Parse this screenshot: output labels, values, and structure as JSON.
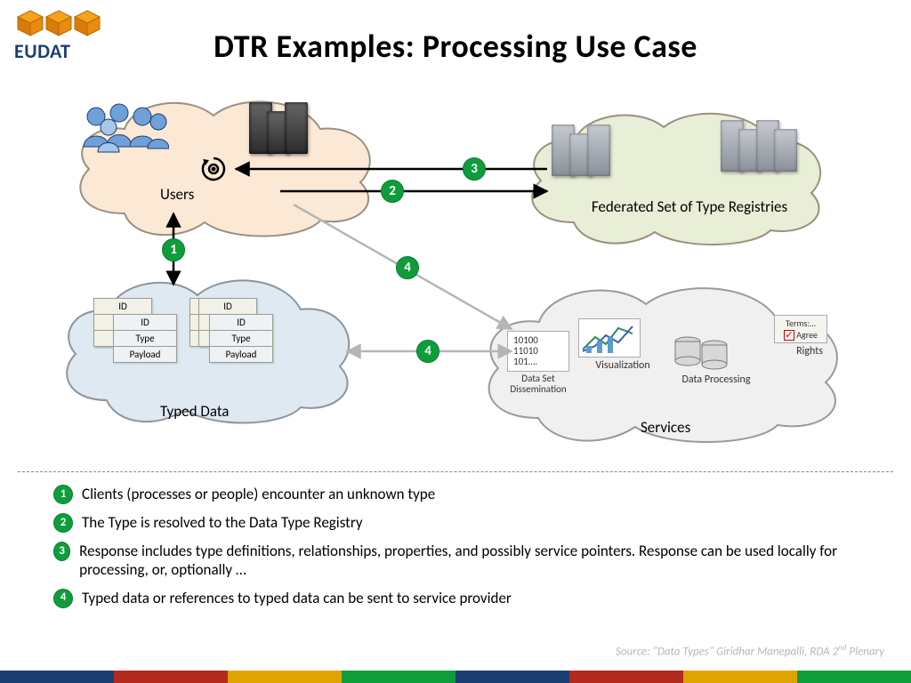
{
  "brand": {
    "name": "EUDAT"
  },
  "title": "DTR Examples: Processing Use Case",
  "clouds": {
    "users": {
      "label": "Users"
    },
    "registries": {
      "label": "Federated Set of Type Registries"
    },
    "typed": {
      "label": "Typed Data",
      "card": {
        "id": "ID",
        "type": "Type",
        "payload": "Payload"
      }
    },
    "services": {
      "label": "Services",
      "dataset_bits": "10100\n11010\n101….",
      "dataset_label": "Data Set Dissemination",
      "visualization": "Visualization",
      "processing": "Data Processing",
      "terms_header": "Terms:…",
      "terms_agree": "Agree",
      "rights": "Rights"
    }
  },
  "arrows": {
    "a1": "1",
    "a2": "2",
    "a3": "3",
    "a4a": "4",
    "a4b": "4"
  },
  "legend": [
    {
      "n": "1",
      "text": "Clients (processes or people) encounter an unknown type"
    },
    {
      "n": "2",
      "text": "The Type is resolved to the Data Type Registry"
    },
    {
      "n": "3",
      "text": "Response includes type definitions, relationships, properties, and possibly service pointers. Response can be used locally for processing, or, optionally …"
    },
    {
      "n": "4",
      "text": "Typed data or references to typed data can be sent to service provider"
    }
  ],
  "source": {
    "prefix": "Source: \"Data Types\" Giridhar Manepalli, RDA 2",
    "ord": "nd",
    "suffix": " Plenary"
  },
  "footer_colors": [
    "#1b3e72",
    "#b32a1e",
    "#e0a400",
    "#0f9d3c",
    "#1b3e72",
    "#b32a1e",
    "#e0a400",
    "#0f9d3c"
  ]
}
